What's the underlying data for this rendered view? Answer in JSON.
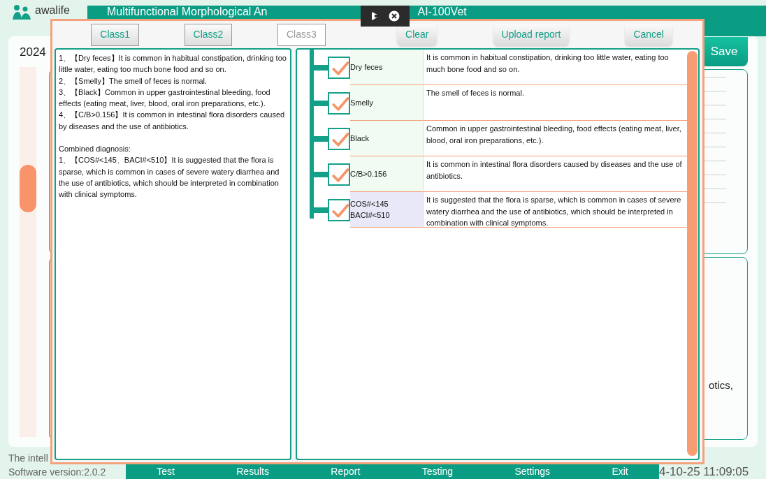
{
  "header": {
    "brand": "awalife",
    "title_start": "Multifunctional Morphological An",
    "title_end": "AI-100Vet"
  },
  "background": {
    "year": "2024",
    "save_button": "Save",
    "partial_text": "otics,",
    "footer_lines": [
      "The intell",
      "Software version:2.0.2"
    ],
    "nav": [
      "Test",
      "Results",
      "Report",
      "Testing",
      "Settings",
      "Exit"
    ],
    "datetime": "4-10-25 11:09:05"
  },
  "dialog": {
    "tabs": [
      {
        "label": "Class1",
        "selected": false
      },
      {
        "label": "Class2",
        "selected": false
      },
      {
        "label": "Class3",
        "selected": true
      }
    ],
    "actions": [
      "Clear",
      "Upload report",
      "Cancel"
    ],
    "summary": [
      {
        "kind": "finding",
        "text": "1、【Dry feces】It is common in habitual constipation, drinking too little water, eating too much bone food and so on."
      },
      {
        "kind": "finding",
        "text": "2、【Smelly】The smell of feces is normal."
      },
      {
        "kind": "finding",
        "text": "3、【Black】Common in upper gastrointestinal bleeding, food effects (eating meat, liver, blood, oral iron preparations, etc.)."
      },
      {
        "kind": "finding",
        "text": "4、【C/B>0.156】It is common in intestinal flora disorders caused by diseases and the use of antibiotics."
      },
      {
        "kind": "heading",
        "text": "Combined diagnosis:"
      },
      {
        "kind": "finding",
        "text": "1、【COS#<145、BACI#<510】It is suggested that the flora is sparse, which is common in cases of severe watery diarrhea and the use of antibiotics, which should be interpreted in combination with clinical symptoms."
      }
    ],
    "findings": [
      {
        "kind": "single",
        "checked": true,
        "label": "Dry feces",
        "description": "It is common in habitual constipation, drinking too little water, eating too much bone food and so on."
      },
      {
        "kind": "single",
        "checked": true,
        "label": "Smelly",
        "description": "The smell of feces is normal."
      },
      {
        "kind": "single",
        "checked": true,
        "label": "Black",
        "description": "Common in upper gastrointestinal bleeding, food effects (eating meat, liver, blood, oral iron preparations, etc.)."
      },
      {
        "kind": "single",
        "checked": true,
        "label": "C/B>0.156",
        "description": "It is common in intestinal flora disorders caused by diseases and the use of antibiotics."
      },
      {
        "kind": "combined",
        "checked": true,
        "label": "COS#<145\nBACI#<510",
        "description": "It is suggested that the flora is sparse, which is common in cases of severe watery diarrhea and the use of antibiotics, which should be interpreted in combination with clinical symptoms."
      }
    ]
  }
}
